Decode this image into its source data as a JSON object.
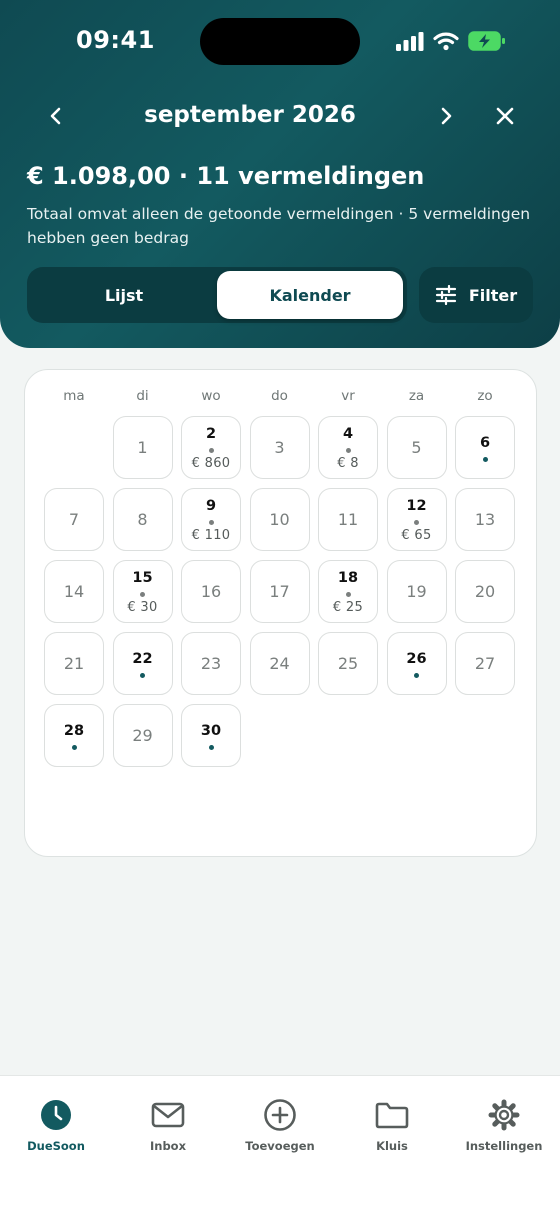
{
  "status": {
    "time": "09:41"
  },
  "header": {
    "month": "september 2026",
    "total": "€ 1.098,00 · 11 vermeldingen",
    "note": "Totaal omvat alleen de getoonde vermeldingen · 5 vermeldingen hebben geen bedrag",
    "icons": {
      "prev": "chevron-left-icon",
      "next": "chevron-right-icon",
      "close": "close-icon"
    }
  },
  "view_toggle": {
    "list_label": "Lijst",
    "calendar_label": "Kalender",
    "selected": "Kalender"
  },
  "filter": {
    "label": "Filter",
    "icon": "sliders-icon"
  },
  "calendar": {
    "weekdays": [
      "ma",
      "di",
      "wo",
      "do",
      "vr",
      "za",
      "zo"
    ],
    "first_weekday_offset": 1,
    "days": [
      {
        "day": "1"
      },
      {
        "day": "2",
        "amount": "€ 860"
      },
      {
        "day": "3"
      },
      {
        "day": "4",
        "amount": "€ 8"
      },
      {
        "day": "5"
      },
      {
        "day": "6",
        "marker": true
      },
      {
        "day": "7"
      },
      {
        "day": "8"
      },
      {
        "day": "9",
        "amount": "€ 110"
      },
      {
        "day": "10"
      },
      {
        "day": "11"
      },
      {
        "day": "12",
        "amount": "€ 65"
      },
      {
        "day": "13"
      },
      {
        "day": "14"
      },
      {
        "day": "15",
        "amount": "€ 30"
      },
      {
        "day": "16"
      },
      {
        "day": "17"
      },
      {
        "day": "18",
        "amount": "€ 25"
      },
      {
        "day": "19"
      },
      {
        "day": "20"
      },
      {
        "day": "21"
      },
      {
        "day": "22",
        "marker": true
      },
      {
        "day": "23"
      },
      {
        "day": "24"
      },
      {
        "day": "25"
      },
      {
        "day": "26",
        "marker": true
      },
      {
        "day": "27"
      },
      {
        "day": "28",
        "marker": true
      },
      {
        "day": "29"
      },
      {
        "day": "30",
        "marker": true
      }
    ]
  },
  "tabbar": {
    "items": [
      {
        "label": "DueSoon",
        "icon": "clock-icon",
        "active": true
      },
      {
        "label": "Inbox",
        "icon": "mail-icon",
        "active": false
      },
      {
        "label": "Toevoegen",
        "icon": "plus-circle-icon",
        "active": false
      },
      {
        "label": "Kluis",
        "icon": "folder-icon",
        "active": false
      },
      {
        "label": "Instellingen",
        "icon": "gear-icon",
        "active": false
      }
    ]
  },
  "colors": {
    "brand": "#135a60",
    "background": "#f2f5f4",
    "battery": "#4cd964"
  }
}
